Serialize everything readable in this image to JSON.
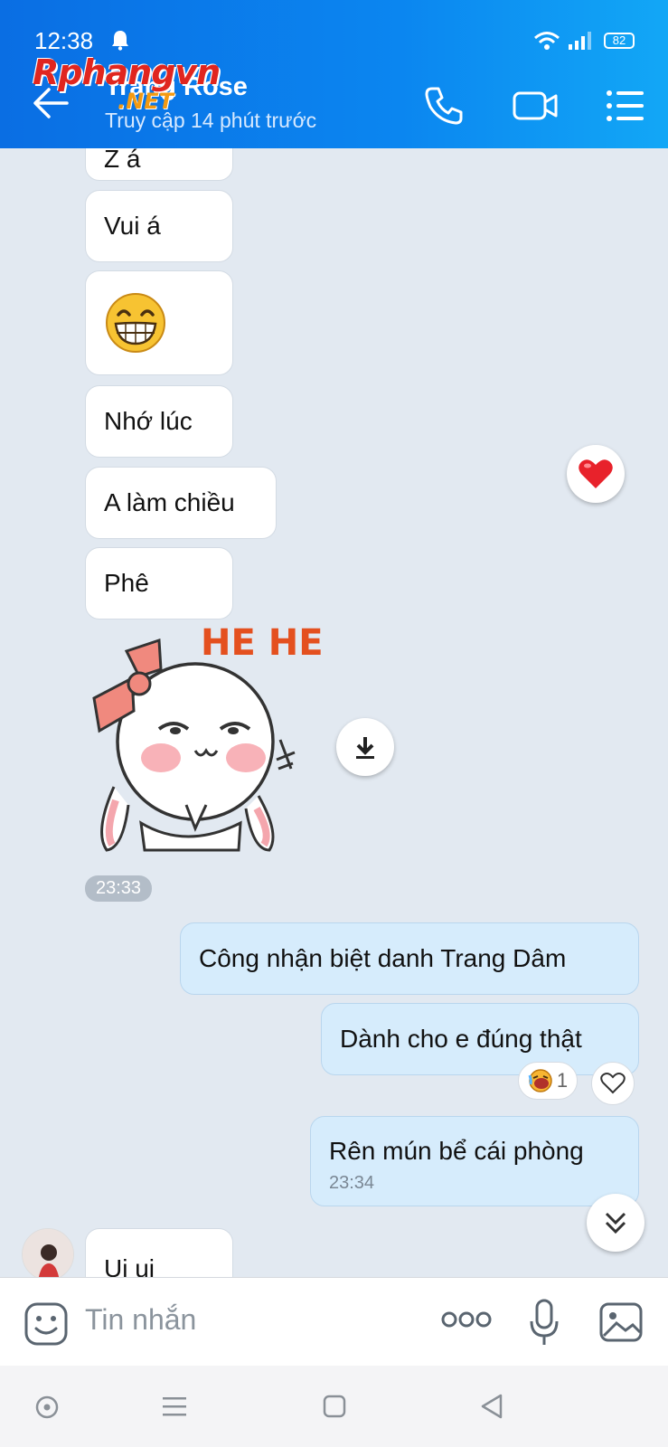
{
  "status_bar": {
    "time": "12:38",
    "battery": "82"
  },
  "header": {
    "watermark": "Rphangvn",
    "watermark_suffix": ".NET",
    "contact_name": "Trang Rose",
    "last_seen": "Truy cập 14 phút trước",
    "icons": [
      "back-arrow-icon",
      "phone-icon",
      "video-call-icon",
      "menu-list-icon"
    ]
  },
  "messages": {
    "m0": "Z á",
    "m1": "Vui á",
    "m2_emoji": "😁",
    "m3": "Nhớ lúc",
    "m4": "A làm chiều",
    "m5": "Phê",
    "sticker_text": "HE HE",
    "sticker_time": "23:33",
    "o1": "Công nhận biệt danh Trang Dâm",
    "o2": "Dành cho e đúng thật",
    "o2_reaction_count": "1",
    "o3": "Rên mún bể cái phòng",
    "o3_time": "23:34",
    "m6": "Ui ui"
  },
  "input": {
    "placeholder": "Tin nhắn"
  },
  "colors": {
    "header_blue": "#0b86f0",
    "outgoing_bubble": "#d6ecfc",
    "chat_bg": "#e2e9f1",
    "heart": "#e8222b"
  }
}
